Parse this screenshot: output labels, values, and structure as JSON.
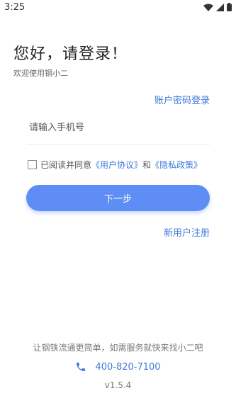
{
  "status_bar": {
    "time": "3:25",
    "icons": [
      "wifi-icon",
      "signal-icon",
      "battery-icon"
    ]
  },
  "greeting": {
    "title": "您好，请登录！",
    "subtitle": "欢迎使用钢小二"
  },
  "account_login_label": "账户密码登录",
  "phone": {
    "placeholder": "请输入手机号",
    "value": ""
  },
  "agreement": {
    "checked": false,
    "prefix": "已阅读并同意",
    "user_agreement": "《用户协议》",
    "and": "和",
    "privacy_policy": "《隐私政策》"
  },
  "next_button_label": "下一步",
  "register_label": "新用户注册",
  "footer": {
    "slogan": "让钢铁流通更简单，如需服务就快来找小二吧",
    "phone_icon": "phone-icon",
    "phone_number": "400-820-7100",
    "version": "v1.5.4"
  },
  "colors": {
    "accent": "#3f7ad9",
    "button": "#5e8ef5"
  }
}
